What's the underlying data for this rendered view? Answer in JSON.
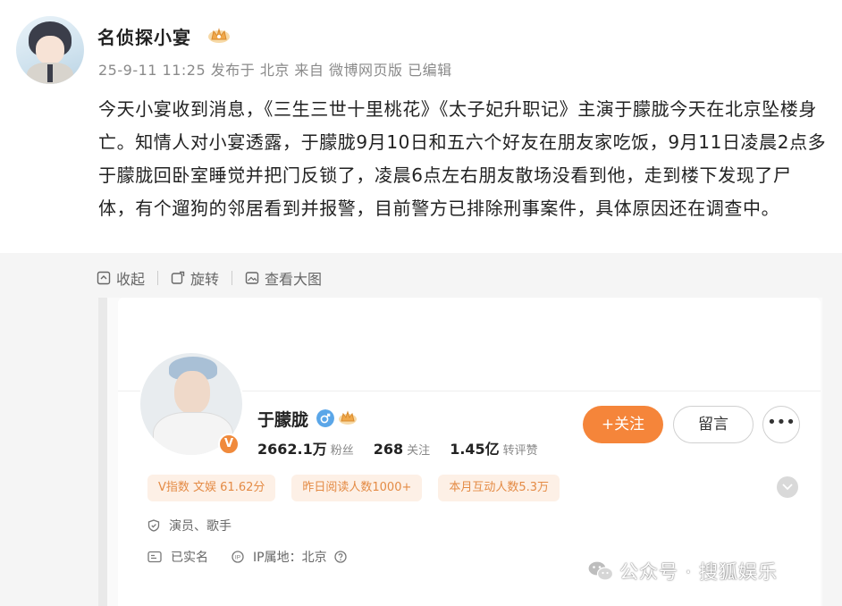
{
  "post": {
    "author_name": "名侦探小宴",
    "meta": "25-9-11 11:25 发布于 北京 来自 微博网页版 已编辑",
    "text": "今天小宴收到消息，《三生三世十里桃花》《太子妃升职记》主演于朦胧今天在北京坠楼身亡。知情人对小宴透露，于朦胧9月10日和五六个好友在朋友家吃饭，9月11日凌晨2点多于朦胧回卧室睡觉并把门反锁了，凌晨6点左右朋友散场没看到他，走到楼下发现了尸体，有个遛狗的邻居看到并报警，目前警方已排除刑事案件，具体原因还在调查中。"
  },
  "toolbar": {
    "collapse": "收起",
    "rotate": "旋转",
    "view_large": "查看大图"
  },
  "profile": {
    "name": "于朦胧",
    "verify_badge": "V",
    "followers_value": "2662.1万",
    "followers_label": "粉丝",
    "following_value": "268",
    "following_label": "关注",
    "interactions_value": "1.45亿",
    "interactions_label": "转评赞",
    "follow_button": "+关注",
    "message_button": "留言",
    "more_button": "•••",
    "tags": [
      "V指数 文娱 61.62分",
      "昨日阅读人数1000+",
      "本月互动人数5.3万"
    ],
    "occupation": "演员、歌手",
    "real_name": "已实名",
    "ip_location": "IP属地：北京"
  },
  "watermark": "公众号 · 搜狐娱乐",
  "colors": {
    "accent_orange": "#f5853a",
    "tag_bg": "#fdf0e6",
    "tag_text": "#e48b45"
  },
  "icons": {
    "collapse": "collapse-icon",
    "rotate": "rotate-icon",
    "view_large": "image-icon",
    "occupation": "shield-icon",
    "real_name": "id-card-icon",
    "ip": "ip-icon",
    "help": "question-icon",
    "gender": "male-icon",
    "crown": "crown-icon",
    "wechat": "wechat-icon"
  }
}
